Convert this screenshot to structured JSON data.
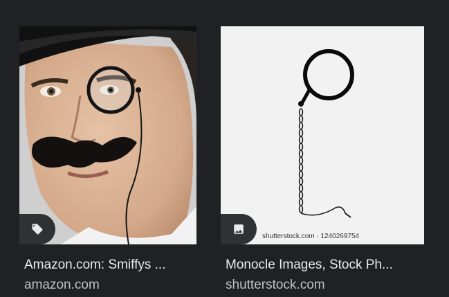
{
  "results": [
    {
      "title": "Amazon.com: Smiffys ...",
      "source": "amazon.com",
      "badge_icon": "tag-icon"
    },
    {
      "title": "Monocle Images, Stock Ph...",
      "source": "shutterstock.com",
      "badge_icon": "image-icon",
      "watermark": "shutterstock.com · 1240269754"
    }
  ],
  "colors": {
    "background": "#202124",
    "title_text": "#e8eaed",
    "source_text": "#bdc1c6",
    "badge_bg": "#303134"
  }
}
